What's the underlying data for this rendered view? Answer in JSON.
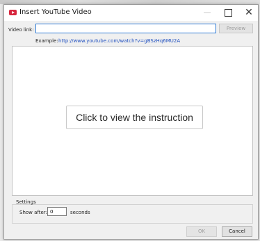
{
  "window": {
    "title": "Insert YouTube Video",
    "icon": "youtube-icon",
    "controls": {
      "minimize": "minimize-icon",
      "maximize": "maximize-icon",
      "close": "close-icon",
      "close_glyph": "✕"
    }
  },
  "video_link": {
    "label": "Video link:",
    "value": "",
    "preview_label": "Preview",
    "example_label": "Example:",
    "example_url": "http://www.youtube.com/watch?v=gBSzHq6MU2A"
  },
  "preview_area": {
    "instruction_label": "Click to view the instruction"
  },
  "settings": {
    "group_label": "Settings",
    "show_after_label": "Show after:",
    "show_after_value": "0",
    "seconds_label": "seconds"
  },
  "footer": {
    "ok_label": "OK",
    "cancel_label": "Cancel"
  },
  "colors": {
    "accent": "#2f7bd6",
    "link": "#1f4fbf",
    "brand": "#d7263d"
  }
}
